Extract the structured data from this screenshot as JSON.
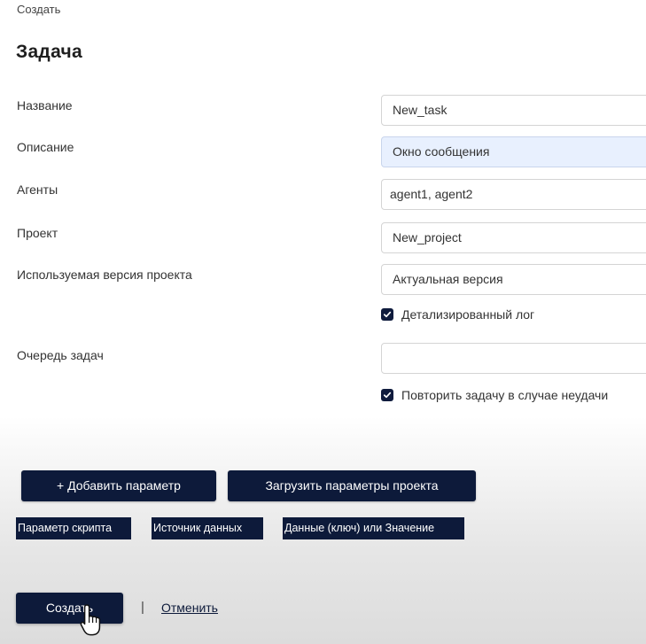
{
  "breadcrumb": "Создать",
  "page_title": "Задача",
  "form": {
    "name": {
      "label": "Название",
      "value": "New_task"
    },
    "description": {
      "label": "Описание",
      "value": "Окно сообщения"
    },
    "agents": {
      "label": "Агенты",
      "value": "agent1, agent2"
    },
    "project": {
      "label": "Проект",
      "value": "New_project"
    },
    "project_version": {
      "label": "Используемая версия проекта",
      "value": "Актуальная версия"
    },
    "detailed_log": {
      "label": "Детализированный лог",
      "checked": true
    },
    "task_queue": {
      "label": "Очередь задач",
      "value": ""
    },
    "retry_on_failure": {
      "label": "Повторить задачу в случае неудачи",
      "checked": true
    }
  },
  "buttons": {
    "add_parameter": "+ Добавить параметр",
    "load_project_parameters": "Загрузить параметры проекта",
    "create": "Создать",
    "cancel": "Отменить",
    "separator": "|"
  },
  "parameter_columns": [
    "Параметр скрипта",
    "Источник данных",
    "Данные (ключ) или Значение"
  ],
  "colors": {
    "accent_dark": "#0d1a3a",
    "field_highlight": "#e8f0fe"
  },
  "icons": {
    "checkbox": "check-icon",
    "cursor": "hand-pointer-icon"
  }
}
